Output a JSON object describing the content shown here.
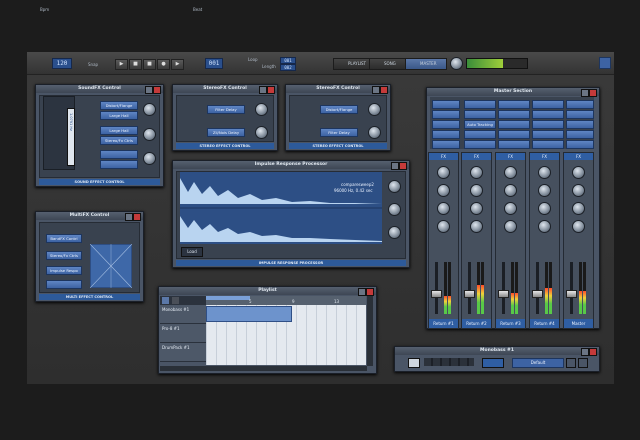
{
  "toolbar": {
    "bpm_label": "Bpm",
    "bpm_value": "120",
    "snap_label": "Snap",
    "beat_label": "Beat",
    "beat_value": "001",
    "loop_label": "Loop",
    "loop_value": "001",
    "length_label": "Length",
    "length_value": "002",
    "tabs": [
      "PLAYLIST",
      "SONG"
    ],
    "active_tab": "MASTER"
  },
  "soundfx": {
    "title": "SoundFX Control",
    "display": "1.0791 Hz",
    "buttons": [
      "Distort/Flange",
      "Large Hall",
      "Large Hall",
      "Stereo/Fx Ctrls"
    ],
    "footer": "SOUND EFFECT CONTROL"
  },
  "stereofx_a": {
    "title": "StereoFX Control",
    "buttons": [
      "Filter Delay",
      "Zil/Nois Delay"
    ],
    "footer": "STEREO EFFECT CONTROL"
  },
  "stereofx_b": {
    "title": "StereoFX Control",
    "buttons": [
      "Distort/Flange",
      "Filter Delay"
    ],
    "footer": "STEREO EFFECT CONTROL"
  },
  "impulse": {
    "title": "Impulse Response Processor",
    "file_name": "comparesweep2",
    "file_info": "96000 Hz, 0.42 sec",
    "load_label": "Load",
    "footer": "IMPULSE RESPONSE PROCESSOR"
  },
  "multifx": {
    "title": "MultiFX Control",
    "buttons": [
      "BandFX Contrl",
      "Stereo/Fx Ctrls",
      "Impulse Respo"
    ],
    "footer": "MULTI EFFECT CONTROL"
  },
  "master": {
    "title": "Master Section",
    "buttons": [
      "Auto Tracking"
    ],
    "fx_label": "FX",
    "channels": [
      {
        "name": "Return #1",
        "meter": 0.35
      },
      {
        "name": "Return #2",
        "meter": 0.55
      },
      {
        "name": "Return #3",
        "meter": 0.4
      },
      {
        "name": "Return #4",
        "meter": 0.5
      },
      {
        "name": "Master",
        "meter": 0.45
      }
    ]
  },
  "playlist": {
    "title": "Playlist",
    "ruler": [
      "5",
      "9",
      "13"
    ],
    "tracks": [
      "Monobass #1",
      "Pro-8 #1",
      "DrumPack #1"
    ]
  },
  "monobass": {
    "title": "Monobass #1",
    "preset": "Default"
  },
  "colors": {
    "accent": "#2f5ea3",
    "close": "#c43a3a"
  }
}
